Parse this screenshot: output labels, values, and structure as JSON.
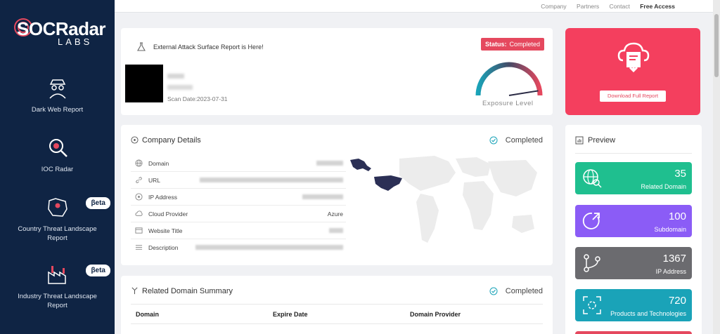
{
  "brand": {
    "name": "SOCRadar",
    "sub": "LABS"
  },
  "nav": [
    {
      "label": "Dark Web Report",
      "icon": "spy-icon",
      "badge": ""
    },
    {
      "label": "IOC Radar",
      "icon": "magnifier-icon",
      "badge": ""
    },
    {
      "label": "Country Threat Landscape Report",
      "icon": "map-pin-icon",
      "badge": "βeta"
    },
    {
      "label": "Industry Threat Landscape Report",
      "icon": "factory-icon",
      "badge": "βeta"
    }
  ],
  "toplinks": [
    "Company",
    "Partners",
    "Contact",
    "Free Access"
  ],
  "report": {
    "title": "External Attack Surface Report is Here!",
    "status_label": "Status:",
    "status_value": "Completed",
    "scan_date": "Scan Date:2023-07-31",
    "gauge_label": "Exposure Level",
    "gauge_level": 0.95
  },
  "download": {
    "button": "Download Full Report"
  },
  "company": {
    "title": "Company Details",
    "status": "Completed",
    "rows": [
      {
        "label": "Domain",
        "icon": "globe-icon",
        "value": ""
      },
      {
        "label": "URL",
        "icon": "link-icon",
        "value": ""
      },
      {
        "label": "IP Address",
        "icon": "location-icon",
        "value": ""
      },
      {
        "label": "Cloud Provider",
        "icon": "cloud-icon",
        "value": "Azure"
      },
      {
        "label": "Website Title",
        "icon": "browser-icon",
        "value": ""
      },
      {
        "label": "Description",
        "icon": "text-lines-icon",
        "value": ""
      }
    ]
  },
  "summary": {
    "title": "Related Domain Summary",
    "status": "Completed",
    "columns": [
      "Domain",
      "Expire Date",
      "Domain Provider"
    ]
  },
  "preview": {
    "title": "Preview",
    "tiles": [
      {
        "value": "35",
        "label": "Related Domain",
        "color": "#1fbf8f",
        "icon": "globe-search-icon"
      },
      {
        "value": "100",
        "label": "Subdomain",
        "color": "#8b5cf6",
        "icon": "arrow-circle-icon"
      },
      {
        "value": "1367",
        "label": "IP Address",
        "color": "#6b6b6f",
        "icon": "branch-icon"
      },
      {
        "value": "720",
        "label": "Products and Technologies",
        "color": "#1aa3b8",
        "icon": "scan-focus-icon"
      }
    ]
  },
  "colors": {
    "sidebar": "#0f2444",
    "accent": "#f43f5e"
  }
}
